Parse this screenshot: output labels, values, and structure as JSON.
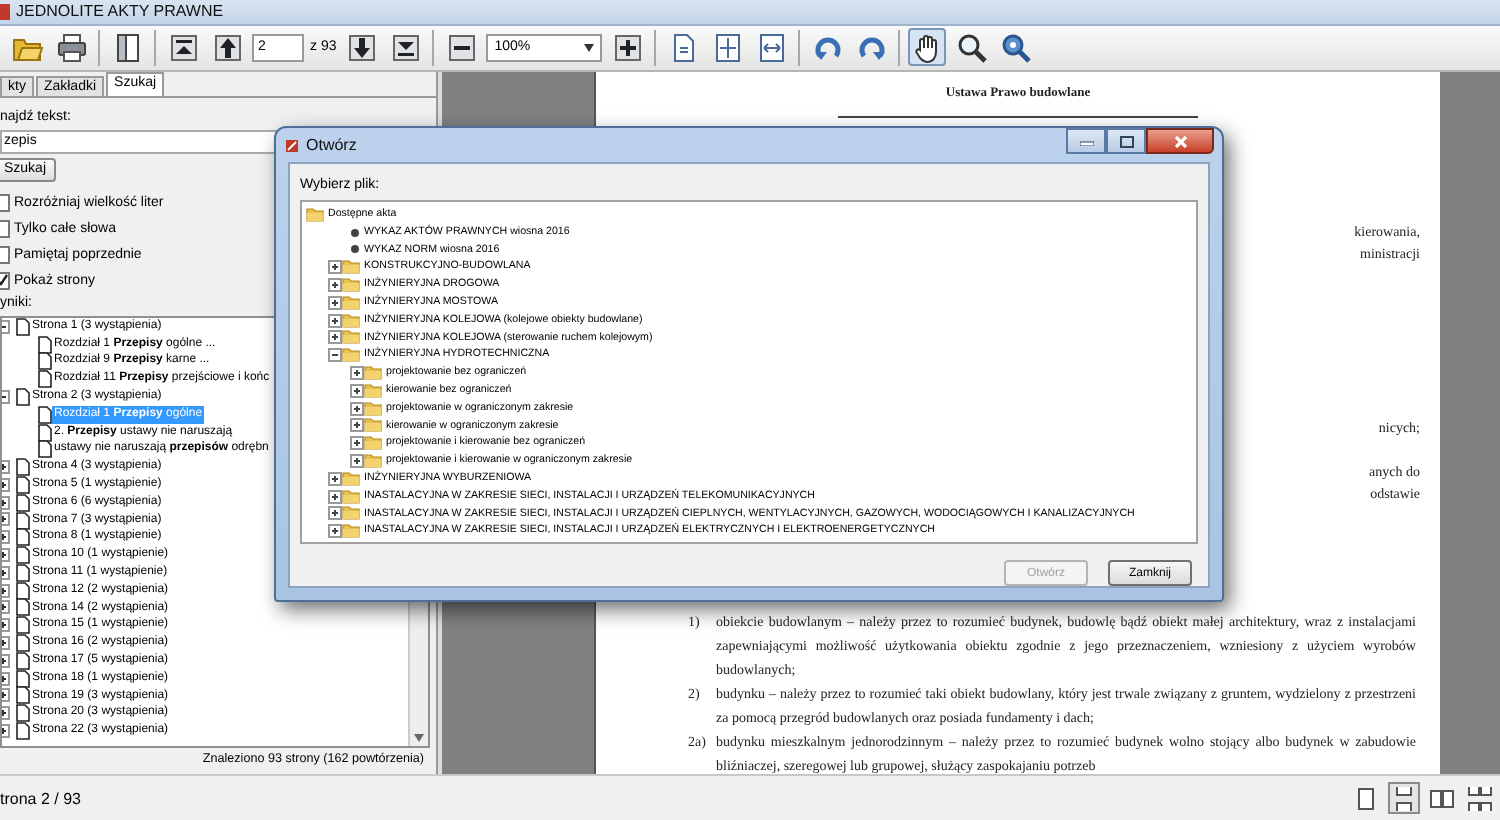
{
  "app": {
    "title": "JEDNOLITE AKTY PRAWNE"
  },
  "toolbar": {
    "groups": [
      [
        {
          "kind": "open",
          "selected": false
        },
        {
          "kind": "print",
          "selected": false
        }
      ],
      [
        {
          "kind": "page-view",
          "selected": false
        }
      ],
      [
        {
          "kind": "first-page",
          "selected": false
        },
        {
          "kind": "prev-page",
          "selected": false
        },
        {
          "kind": "page-field",
          "value": "2"
        },
        {
          "kind": "label",
          "text": "z 93"
        },
        {
          "kind": "next-page",
          "selected": false
        },
        {
          "kind": "last-page",
          "selected": false
        }
      ],
      [
        {
          "kind": "zoom-out",
          "selected": false
        },
        {
          "kind": "zoom-field",
          "value": "100%"
        },
        {
          "kind": "zoom-in",
          "selected": false
        }
      ],
      [
        {
          "kind": "actual-size",
          "selected": false
        },
        {
          "kind": "fit-page",
          "selected": false
        },
        {
          "kind": "fit-width",
          "selected": false
        }
      ],
      [
        {
          "kind": "rotate-left",
          "selected": false
        },
        {
          "kind": "rotate-right",
          "selected": false
        }
      ],
      [
        {
          "kind": "hand",
          "selected": true
        },
        {
          "kind": "zoom-tool",
          "selected": false
        },
        {
          "kind": "zoom-help",
          "selected": false
        }
      ]
    ]
  },
  "sidebar": {
    "tabs": [
      {
        "label": "kty",
        "selected": false
      },
      {
        "label": "Zakładki",
        "selected": false
      },
      {
        "label": "Szukaj",
        "selected": true
      }
    ],
    "search_label": "najdź tekst:",
    "search_value": "zepis",
    "search_button": "Szukaj",
    "options": [
      {
        "label": "Rozróżniaj wielkość liter",
        "checked": false
      },
      {
        "label": "Tylko całe słowa",
        "checked": false
      },
      {
        "label": "Pamiętaj poprzednie",
        "checked": false
      },
      {
        "label": "Pokaż strony",
        "checked": true
      }
    ],
    "results_label": "yniki:",
    "results": [
      {
        "label": "Strona 1 (3 wystąpienia)",
        "expanded": true,
        "children": [
          {
            "label": "Rozdział 1 **Przepisy** ogólne ...",
            "selected": false
          },
          {
            "label": "Rozdział 9 **Przepisy** karne ...",
            "selected": false
          },
          {
            "label": "Rozdział 11 **Przepisy** przejściowe i końc",
            "selected": false
          }
        ]
      },
      {
        "label": "Strona 2 (3 wystąpienia)",
        "expanded": true,
        "children": [
          {
            "label": "Rozdział 1 **Przepisy** ogólne",
            "selected": true
          },
          {
            "label": "2. **Przepisy** ustawy nie naruszają",
            "selected": false
          },
          {
            "label": "ustawy nie naruszają **przepisów** odrębn",
            "selected": false
          }
        ]
      },
      {
        "label": "Strona 4 (3 wystąpienia)",
        "expanded": false
      },
      {
        "label": "Strona 5 (1 wystąpienie)",
        "expanded": false
      },
      {
        "label": "Strona 6 (6 wystąpienia)",
        "expanded": false
      },
      {
        "label": "Strona 7 (3 wystąpienia)",
        "expanded": false
      },
      {
        "label": "Strona 8 (1 wystąpienie)",
        "expanded": false
      },
      {
        "label": "Strona 10 (1 wystąpienie)",
        "expanded": false
      },
      {
        "label": "Strona 11 (1 wystąpienie)",
        "expanded": false
      },
      {
        "label": "Strona 12 (2 wystąpienia)",
        "expanded": false
      },
      {
        "label": "Strona 14 (2 wystąpienia)",
        "expanded": false
      },
      {
        "label": "Strona 15 (1 wystąpienie)",
        "expanded": false
      },
      {
        "label": "Strona 16 (2 wystąpienia)",
        "expanded": false
      },
      {
        "label": "Strona 17 (5 wystąpienia)",
        "expanded": false
      },
      {
        "label": "Strona 18 (1 wystąpienie)",
        "expanded": false
      },
      {
        "label": "Strona 19 (3 wystąpienia)",
        "expanded": false
      },
      {
        "label": "Strona 20 (3 wystąpienia)",
        "expanded": false
      },
      {
        "label": "Strona 22 (3 wystąpienia)",
        "expanded": false
      }
    ],
    "summary": "Znaleziono 93 strony (162 powtórzenia)"
  },
  "document": {
    "title": "Ustawa Prawo budowlane",
    "fragments": [
      "kierowania,",
      "ministracji",
      "nicych;",
      "anych do",
      "odstawie"
    ],
    "paragraphs": [
      {
        "number": "1)",
        "text": "obiekcie budowlanym – należy przez to rozumieć budynek, budowlę bądź obiekt małej architektury, wraz z instalacjami zapewniającymi możliwość użytkowania obiektu zgodnie z jego przeznaczeniem, wzniesiony z użyciem wyrobów budowlanych;"
      },
      {
        "number": "2)",
        "text": "budynku – należy przez to rozumieć taki obiekt budowlany, który jest trwale związany z gruntem, wydzielony z przestrzeni za pomocą przegród budowlanych oraz posiada fundamenty i dach;"
      },
      {
        "number": "2a)",
        "text": "budynku mieszkalnym jednorodzinnym – należy przez to rozumieć budynek wolno stojący albo budynek w zabudowie bliźniaczej, szeregowej lub grupowej, służący zaspokajaniu potrzeb"
      }
    ]
  },
  "dialog": {
    "title": "Otwórz",
    "label": "Wybierz plik:",
    "tree": {
      "label": "Dostępne akta",
      "expanded": true,
      "children": [
        {
          "kind": "file",
          "label": "WYKAZ AKTÓW PRAWNYCH wiosna 2016"
        },
        {
          "kind": "file",
          "label": "WYKAZ NORM wiosna 2016"
        },
        {
          "kind": "folder",
          "label": "KONSTRUKCYJNO-BUDOWLANA",
          "expanded": false
        },
        {
          "kind": "folder",
          "label": "INŻYNIERYJNA DROGOWA",
          "expanded": false
        },
        {
          "kind": "folder",
          "label": "INŻYNIERYJNA MOSTOWA",
          "expanded": false
        },
        {
          "kind": "folder",
          "label": "INŻYNIERYJNA KOLEJOWA (kolejowe obiekty budowlane)",
          "expanded": false
        },
        {
          "kind": "folder",
          "label": "INŻYNIERYJNA KOLEJOWA (sterowanie ruchem kolejowym)",
          "expanded": false
        },
        {
          "kind": "folder",
          "label": "INŻYNIERYJNA HYDROTECHNICZNA",
          "expanded": true,
          "children": [
            {
              "label": "projektowanie bez ograniczeń",
              "expanded": false
            },
            {
              "label": "kierowanie bez ograniczeń",
              "expanded": false
            },
            {
              "label": "projektowanie w ograniczonym zakresie",
              "expanded": false
            },
            {
              "label": "kierowanie w ograniczonym zakresie",
              "expanded": false
            },
            {
              "label": "projektowanie i kierowanie bez ograniczeń",
              "expanded": false
            },
            {
              "label": "projektowanie i kierowanie w ograniczonym zakresie",
              "expanded": false
            }
          ]
        },
        {
          "kind": "folder",
          "label": "INŻYNIERYJNA WYBURZENIOWA",
          "expanded": false
        },
        {
          "kind": "folder",
          "label": "INASTALACYJNA W ZAKRESIE SIECI, INSTALACJI I URZĄDZEŃ TELEKOMUNIKACYJNYCH",
          "expanded": false
        },
        {
          "kind": "folder",
          "label": "INASTALACYJNA W ZAKRESIE SIECI, INSTALACJI I URZĄDZEŃ CIEPLNYCH, WENTYLACYJNYCH, GAZOWYCH, WODOCIĄGOWYCH I KANALIZACYJNYCH",
          "expanded": false
        },
        {
          "kind": "folder",
          "label": "INASTALACYJNA W ZAKRESIE SIECI, INSTALACJI I URZĄDZEŃ ELEKTRYCZNYCH I ELEKTROENERGETYCZNYCH",
          "expanded": false
        }
      ]
    },
    "buttons": [
      {
        "label": "Otwórz",
        "disabled": true
      },
      {
        "label": "Zamknij",
        "disabled": false
      }
    ]
  },
  "status_bar": {
    "page": "trona 2 / 93",
    "view_modes": [
      {
        "kind": "single",
        "selected": false
      },
      {
        "kind": "continuous",
        "selected": true
      },
      {
        "kind": "facing",
        "selected": false
      },
      {
        "kind": "continuous-facing",
        "selected": false
      }
    ]
  }
}
